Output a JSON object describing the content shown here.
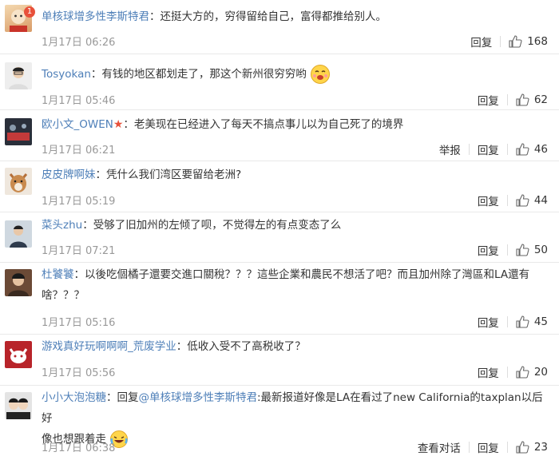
{
  "comments": [
    {
      "user": "单核球增多性李斯特君",
      "badge": "1",
      "text": "：还挺大方的，穷得留给自己，富得都推给别人。",
      "date": "1月17日 06:26",
      "reply": "回复",
      "likes": "168"
    },
    {
      "user": "Tosyokan",
      "text": "：有钱的地区都划走了，那这个新州很穷穷哟",
      "date": "1月17日 05:46",
      "reply": "回复",
      "likes": "62"
    },
    {
      "user": "欧小文_OWEN",
      "text": "：老美现在已经进入了每天不搞点事儿以为自己死了的境界",
      "date": "1月17日 06:21",
      "report": "举报",
      "reply": "回复",
      "likes": "46"
    },
    {
      "user": "皮皮牌啊妹",
      "text": "：凭什么我们湾区要留给老洲?",
      "date": "1月17日 05:19",
      "reply": "回复",
      "likes": "44"
    },
    {
      "user": "菜头zhu",
      "text": "：受够了旧加州的左倾了呗，不觉得左的有点变态了么",
      "date": "1月17日 07:21",
      "reply": "回复",
      "likes": "50"
    },
    {
      "user": "杜饕饕",
      "text_line1": "：以後吃個橘子還要交進口關稅？？？這些企業和農民不想活了吧？而且加州除了灣區和LA還有",
      "text_line2": "啥？？？",
      "date": "1月17日 05:16",
      "reply": "回复",
      "likes": "45"
    },
    {
      "user": "游戏真好玩啊啊啊_荒废学业",
      "text": "：低收入受不了高税收了？",
      "date": "1月17日 05:56",
      "reply": "回复",
      "likes": "20"
    },
    {
      "user": "小小大泡泡糖",
      "reply_prefix": "：回复",
      "mention": "@单核球增多性李斯特君",
      "text_line1": ":最新报道好像是LA在看过了new California的taxplan以后好",
      "text_line2": "像也想跟着走",
      "date": "1月17日 06:38",
      "view_convo": "查看对话",
      "reply": "回复",
      "likes": "23"
    }
  ]
}
